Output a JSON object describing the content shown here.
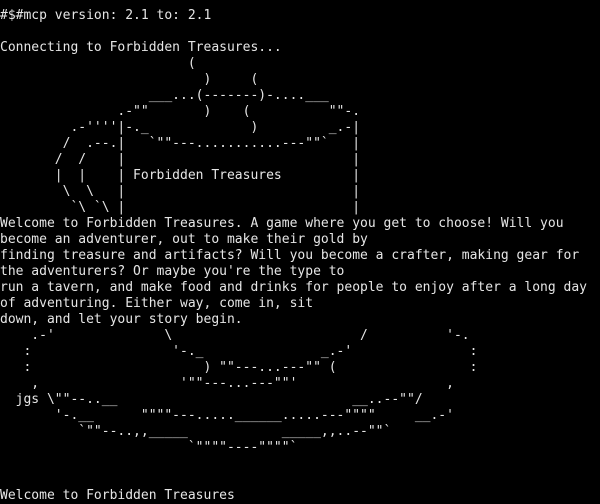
{
  "terminal": {
    "foreground": "#e6e6e6",
    "background": "#000000",
    "lines": [
      "#$#mcp version: 2.1 to: 2.1",
      "",
      "Connecting to Forbidden Treasures...",
      "                        (",
      "                          )     (",
      "                   ___...(-------)-....___",
      "               .-\"\"       )    (          \"\"-.",
      "         .-''''|-._             )         _.-|",
      "        /  .--.|   `\"\"---...........---\"\"`   |",
      "       /  /    |                             |",
      "       |  |    | Forbidden Treasures         |",
      "        \\  \\   |                             |",
      "         `\\ `\\ |                             |",
      "Welcome to Forbidden Treasures. A game where you get to choose! Will you",
      "become an adventurer, out to make their gold by",
      "finding treasure and artifacts? Will you become a crafter, making gear for",
      "the adventurers? Or maybe you're the type to",
      "run a tavern, and make food and drinks for people to enjoy after a long day",
      "of adventuring. Either way, come in, sit",
      "down, and let your story begin.",
      "    .-'              \\                        /          '-.",
      "   :                  '-._               _.-'               :",
      "   :                      ) \"\"---...---\"\" (                 :",
      "    ,                  '\"\"---...---\"\"'                   ,",
      "  jgs \\\"\"--..__                              __..--\"\"/",
      "       '-.__      \"\"\"\"---.....______.....---\"\"\"\"     __.-'",
      "          `\"\"--..,,_____            _____,,..--\"\"`",
      "                        `\"\"\"\"----\"\"\"\"`",
      "",
      "",
      "Welcome to Forbidden Treasures"
    ]
  }
}
